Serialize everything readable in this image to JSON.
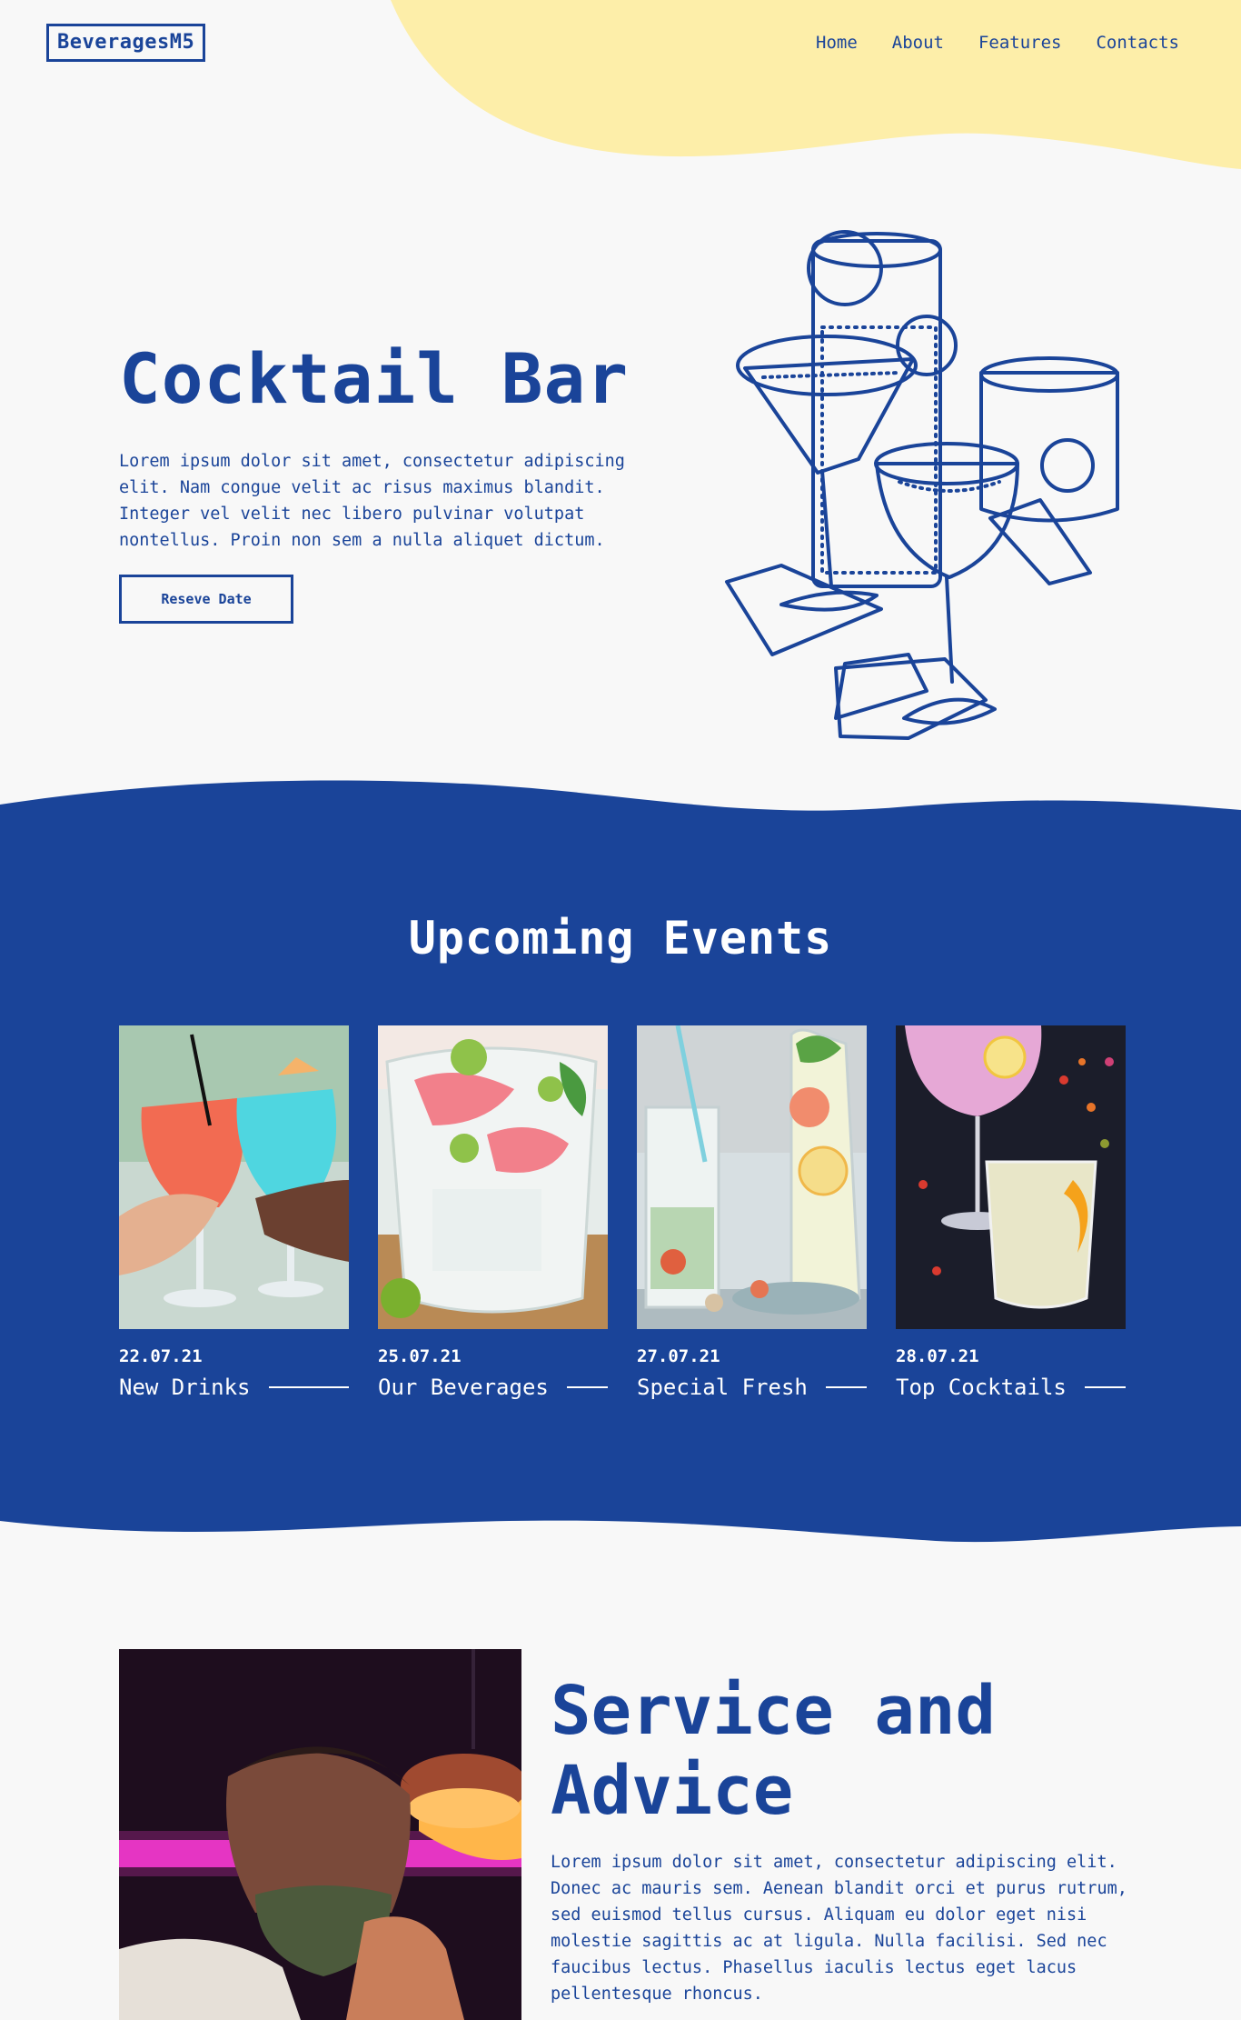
{
  "header": {
    "logo": "BeveragesM5",
    "nav": [
      "Home",
      "About",
      "Features",
      "Contacts"
    ]
  },
  "hero": {
    "title": "Cocktail Bar",
    "text": "Lorem ipsum dolor sit amet, consectetur adipiscing elit. Nam congue velit ac risus maximus blandit. Integer vel velit nec libero pulvinar volutpat nontellus. Proin non sem a nulla aliquet dictum.",
    "button": "Reseve Date"
  },
  "events": {
    "title": "Upcoming Events",
    "cards": [
      {
        "date": "22.07.21",
        "title": "New Drinks"
      },
      {
        "date": "25.07.21",
        "title": "Our Beverages"
      },
      {
        "date": "27.07.21",
        "title": "Special Fresh"
      },
      {
        "date": "28.07.21",
        "title": "Top Cocktails"
      }
    ]
  },
  "service": {
    "title": "Service and Advice",
    "text": "Lorem ipsum dolor sit amet, consectetur adipiscing elit. Donec ac mauris sem. Aenean blandit orci et purus rutrum, sed euismod tellus cursus. Aliquam eu dolor eget nisi molestie sagittis ac at ligula. Nulla facilisi. Sed nec faucibus lectus. Phasellus iaculis lectus eget lacus pellentesque rhoncus."
  },
  "colors": {
    "primary": "#1a4499",
    "accent_yellow": "#fdeea9",
    "background": "#f8f8f8"
  }
}
